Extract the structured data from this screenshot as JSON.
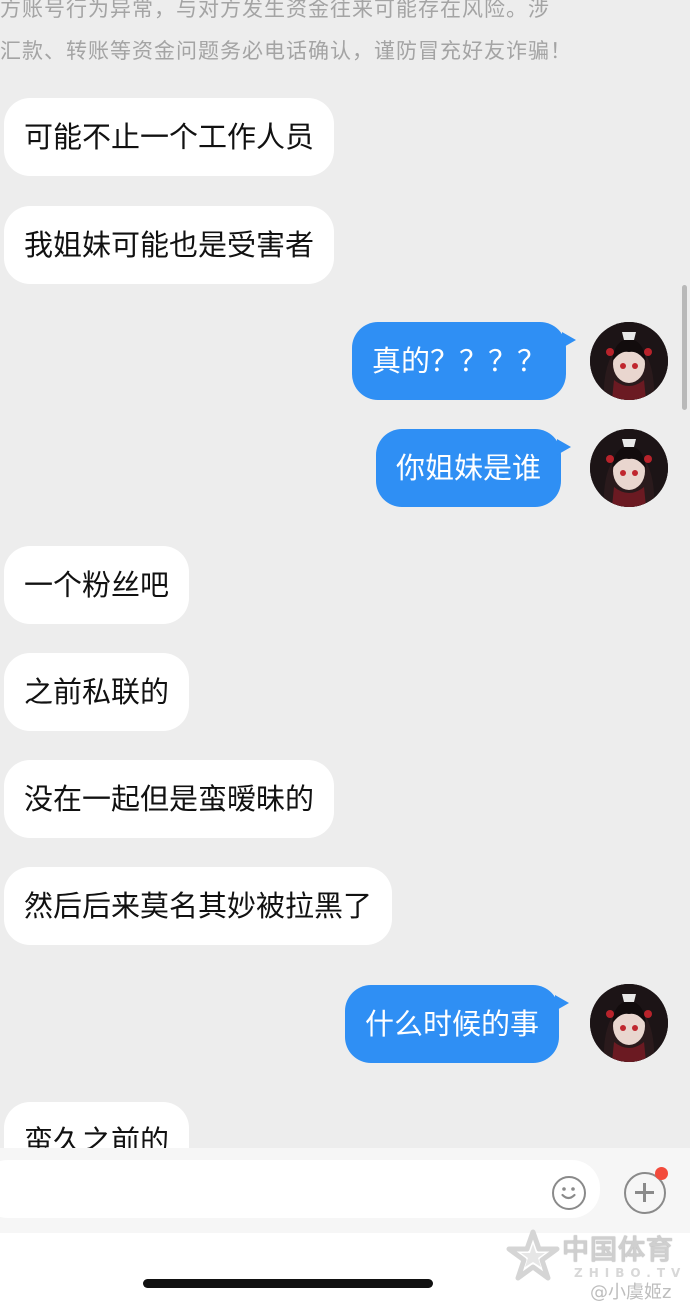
{
  "notice": {
    "line1": "方账号行为异常，与对方发生资金往来可能存在风险。涉",
    "line2": "汇款、转账等资金问题务必电话确认，谨防冒充好友诈骗！"
  },
  "messages": [
    {
      "side": "in",
      "text": "可能不止一个工作人员"
    },
    {
      "side": "in",
      "text": "我姐妹可能也是受害者"
    },
    {
      "side": "out",
      "text": "真的？？？？"
    },
    {
      "side": "out",
      "text": "你姐妹是谁"
    },
    {
      "side": "in",
      "text": "一个粉丝吧"
    },
    {
      "side": "in",
      "text": "之前私联的"
    },
    {
      "side": "in",
      "text": "没在一起但是蛮暧昧的"
    },
    {
      "side": "in",
      "text": "然后后来莫名其妙被拉黑了"
    },
    {
      "side": "out",
      "text": "什么时候的事"
    },
    {
      "side": "in",
      "text": "蛮久之前的"
    }
  ],
  "input_bar": {
    "emoji_icon": "smiley-icon",
    "plus_icon": "plus-circle-icon",
    "badge_color": "#f34b3c"
  },
  "watermark": {
    "brand": "中国体育",
    "sub": "ZHIBO.TV",
    "user": "@小虞姬z"
  },
  "colors": {
    "background": "#ededed",
    "outgoing_bubble": "#2f8ff4",
    "incoming_bubble": "#ffffff"
  }
}
